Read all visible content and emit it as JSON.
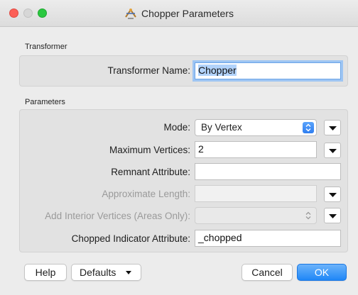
{
  "window": {
    "title": "Chopper Parameters",
    "icon": "chopper-transformer-icon"
  },
  "transformer_group": {
    "label": "Transformer",
    "name_label": "Transformer Name:",
    "name_value": "Chopper"
  },
  "parameters_group": {
    "label": "Parameters",
    "mode_label": "Mode:",
    "mode_value": "By Vertex",
    "max_vertices_label": "Maximum Vertices:",
    "max_vertices_value": "2",
    "remnant_label": "Remnant Attribute:",
    "remnant_value": "",
    "approx_length_label": "Approximate Length:",
    "approx_length_value": "",
    "interior_vertices_label": "Add Interior Vertices (Areas Only):",
    "interior_vertices_value": "",
    "chopped_indicator_label": "Chopped Indicator Attribute:",
    "chopped_indicator_value": "_chopped"
  },
  "footer": {
    "help": "Help",
    "defaults": "Defaults",
    "cancel": "Cancel",
    "ok": "OK"
  },
  "colors": {
    "accent": "#1f87f7",
    "focus_ring": "#9ec5f3",
    "disabled_text": "#9a9a9a"
  }
}
